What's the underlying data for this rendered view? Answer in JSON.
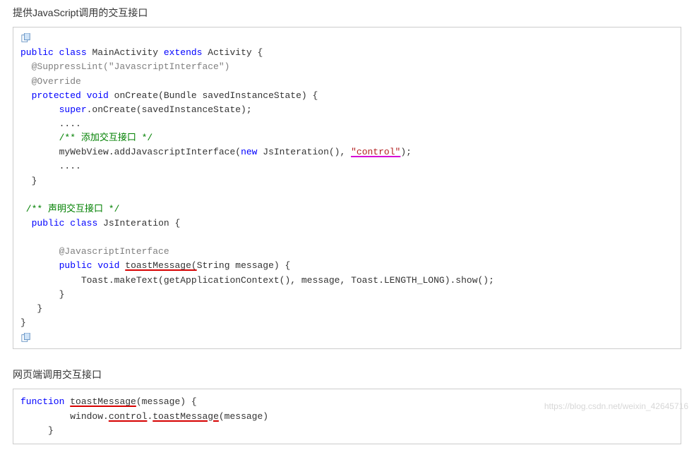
{
  "section1": {
    "title": "提供JavaScript调用的交互接口",
    "copy_icon": "copy-icon",
    "code": {
      "l1_a": "public",
      "l1_b": "class",
      "l1_c": " MainActivity ",
      "l1_d": "extends",
      "l1_e": " Activity {",
      "l2": "  @SuppressLint(\"JavascriptInterface\")",
      "l3": "  @Override",
      "l4_a": "  ",
      "l4_b": "protected",
      "l4_c": " ",
      "l4_d": "void",
      "l4_e": " onCreate(Bundle savedInstanceState) {",
      "l5_a": "       ",
      "l5_b": "super",
      "l5_c": ".onCreate(savedInstanceState);",
      "l6": "       ....",
      "l7": "       /** 添加交互接口 */",
      "l8_a": "       myWebView.addJavascriptInterface(",
      "l8_b": "new",
      "l8_c": " JsInteration(), ",
      "l8_d": "\"control\"",
      "l8_e": ");",
      "l9": "       ....",
      "l10": "  }",
      "blank1": "",
      "l11": " /** 声明交互接口 */",
      "l12_a": "  ",
      "l12_b": "public",
      "l12_c": " ",
      "l12_d": "class",
      "l12_e": " JsInteration {",
      "blank2": "",
      "l13": "       @JavascriptInterface",
      "l14_a": "       ",
      "l14_b": "public",
      "l14_c": " ",
      "l14_d": "void",
      "l14_e": " ",
      "l14_f": "toastMessage(",
      "l14_g": "String message) {",
      "l15": "           Toast.makeText(getApplicationContext(), message, Toast.LENGTH_LONG).show();",
      "l16": "       }",
      "l17": "   }",
      "l18": "}"
    }
  },
  "section2": {
    "title": "网页端调用交互接口",
    "code": {
      "l1_a": "function",
      "l1_b": " ",
      "l1_c": "toastMessage",
      "l1_d": "(message) {",
      "l2_a": "         window.",
      "l2_b": "control",
      "l2_c": ".",
      "l2_d": "toastMessage",
      "l2_e": "(message)",
      "l3": "     }"
    }
  },
  "watermark": "https://blog.csdn.net/weixin_42645716"
}
